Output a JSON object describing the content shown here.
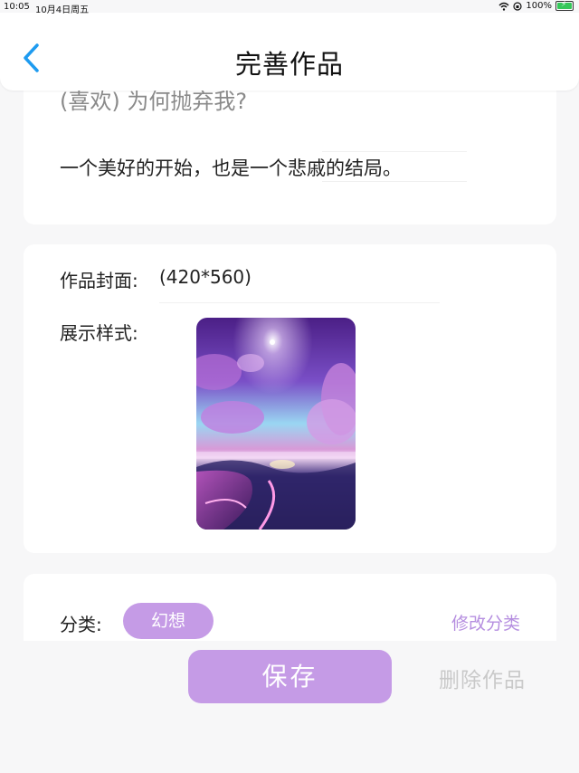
{
  "status_bar": {
    "time": "10:05",
    "date": "10月4日周五",
    "battery": "100%"
  },
  "nav": {
    "title": "完善作品"
  },
  "work": {
    "faded_line": "(喜欢) 为何抛弃我?",
    "description": "一个美好的开始，也是一个悲戚的结局。"
  },
  "cover": {
    "label": "作品封面:",
    "size": "(420*560)",
    "style_label": "展示样式:"
  },
  "category": {
    "label": "分类:",
    "value": "幻想",
    "modify": "修改分类"
  },
  "actions": {
    "save": "保存",
    "delete": "删除作品"
  },
  "colors": {
    "accent": "#c59be6",
    "link": "#b68fe0",
    "back_arrow": "#1e9bf0"
  }
}
